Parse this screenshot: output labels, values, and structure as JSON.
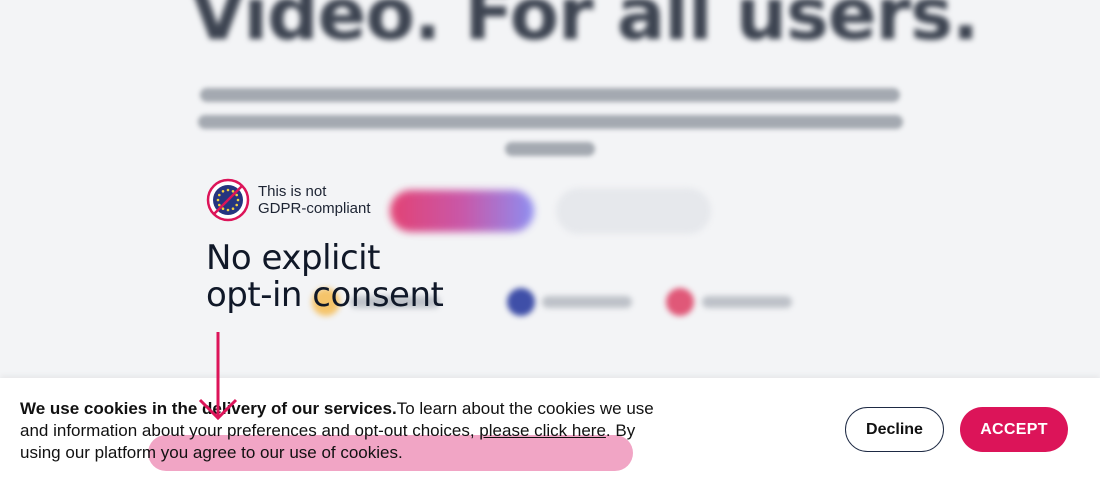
{
  "background_page": {
    "headline": "Video. For all users."
  },
  "annotation": {
    "badge_text_line1": "This is not",
    "badge_text_line2": "GDPR-compliant",
    "badge_icon": "eu-flag-prohibited-icon",
    "headline_line1": "No explicit",
    "headline_line2": "opt-in consent",
    "arrow_icon": "arrow-down-icon",
    "accent_color": "#dc1459"
  },
  "cookie_banner": {
    "bold_text": "We use cookies in the delivery of our services.",
    "text_part2": "To learn about the cookies we use and information about your preferences and opt-out choices, ",
    "link_text": "please click here",
    "text_part3": ". By using our platform you agree to our use of cookies.",
    "decline_label": "Decline",
    "accept_label": "ACCEPT",
    "accept_color": "#dc1459"
  }
}
